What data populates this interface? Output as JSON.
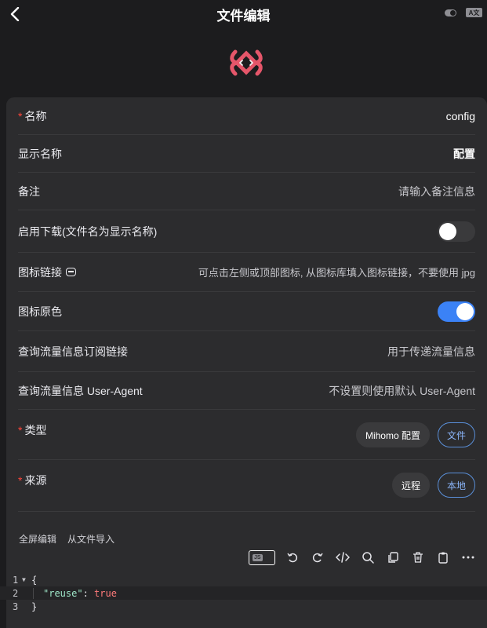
{
  "header": {
    "title": "文件编辑",
    "translate_icon_text": "A文"
  },
  "form": {
    "name": {
      "label": "名称",
      "value": "config"
    },
    "display_name": {
      "label": "显示名称",
      "value": "配置"
    },
    "remark": {
      "label": "备注",
      "placeholder": "请输入备注信息"
    },
    "enable_download": {
      "label": "启用下载(文件名为显示名称)",
      "enabled": false
    },
    "icon_link": {
      "label": "图标链接",
      "placeholder": "可点击左侧或顶部图标, 从图标库填入图标链接，不要使用 jpg"
    },
    "icon_original_color": {
      "label": "图标原色",
      "enabled": true
    },
    "traffic_sub_link": {
      "label": "查询流量信息订阅链接",
      "placeholder": "用于传递流量信息"
    },
    "traffic_user_agent": {
      "label": "查询流量信息 User-Agent",
      "placeholder": "不设置则使用默认 User-Agent"
    },
    "type": {
      "label": "类型",
      "options": [
        "Mihomo 配置",
        "文件"
      ],
      "selected": "文件"
    },
    "source": {
      "label": "来源",
      "options": [
        "远程",
        "本地"
      ],
      "selected": "本地"
    }
  },
  "editor": {
    "actions": [
      "全屏编辑",
      "从文件导入"
    ],
    "js_badge": "JS",
    "toolbar_icons": [
      "undo-icon",
      "redo-icon",
      "code-icon",
      "search-icon",
      "copy-icon",
      "delete-icon",
      "paste-icon",
      "more-icon"
    ],
    "line_numbers": [
      "1",
      "2",
      "3"
    ],
    "code": {
      "open": "{",
      "key": "\"reuse\"",
      "colon": ":",
      "value": "true",
      "close": "}"
    }
  },
  "colors": {
    "accent": "#3b82f6",
    "required": "#ff453a",
    "logo": "#e5566a"
  }
}
